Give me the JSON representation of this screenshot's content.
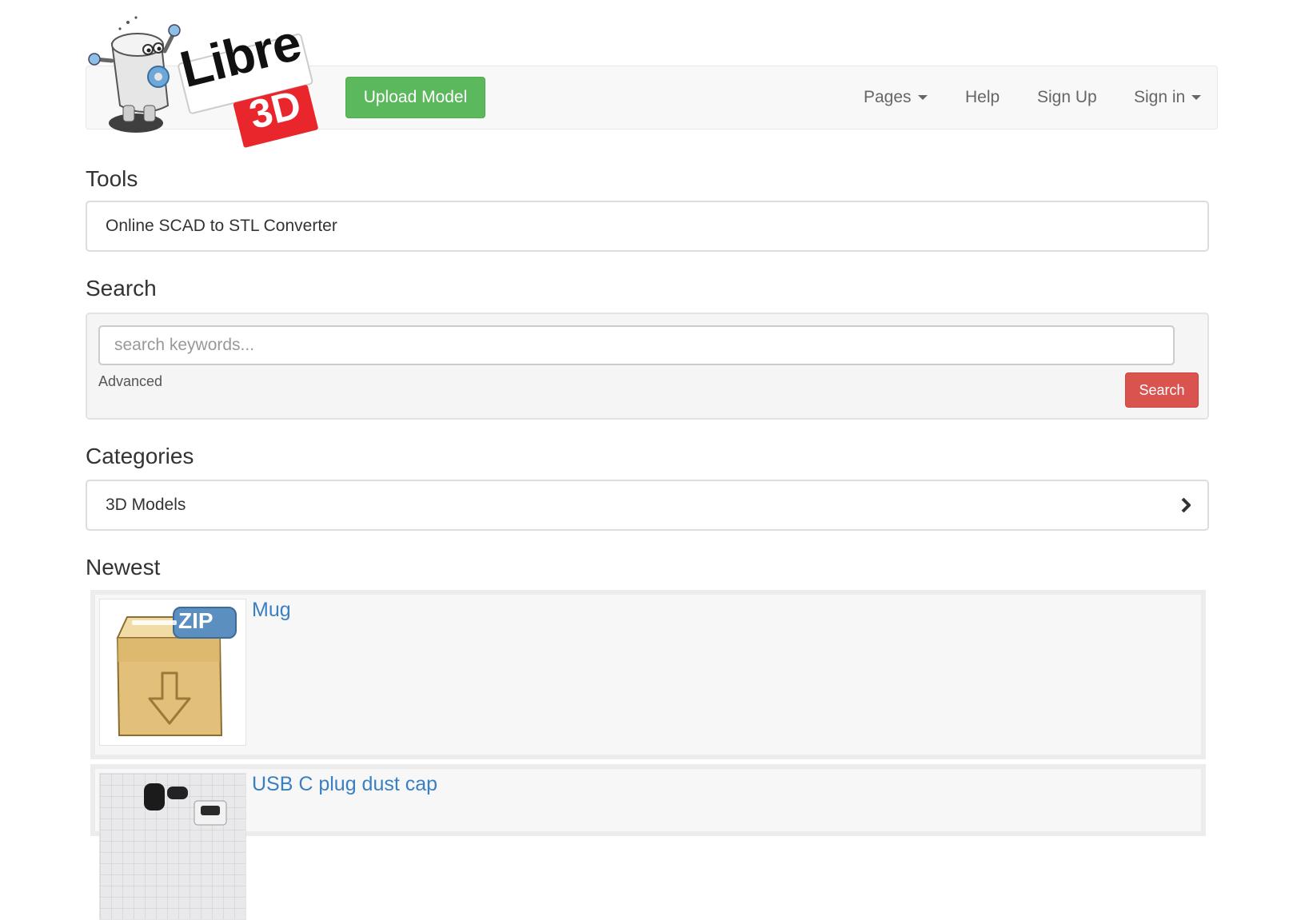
{
  "header": {
    "logo": {
      "word": "Libre",
      "badge": "3D",
      "icon": "robot-mascot-icon"
    },
    "upload_label": "Upload Model",
    "nav": {
      "pages_label": "Pages",
      "help_label": "Help",
      "signup_label": "Sign Up",
      "signin_label": "Sign in"
    }
  },
  "tools": {
    "heading": "Tools",
    "items": [
      "Online SCAD to STL Converter"
    ]
  },
  "search": {
    "heading": "Search",
    "placeholder": "search keywords...",
    "value": "",
    "advanced_label": "Advanced",
    "button_label": "Search"
  },
  "categories": {
    "heading": "Categories",
    "items": [
      {
        "label": "3D Models",
        "icon": "chevron-right-icon"
      }
    ]
  },
  "newest": {
    "heading": "Newest",
    "items": [
      {
        "title": "Mug",
        "thumbnail": "zip-archive-icon",
        "thumbnail_badge": "ZIP"
      },
      {
        "title": "USB C plug dust cap",
        "thumbnail": "photo-thumbnail"
      }
    ]
  },
  "colors": {
    "upload_button": "#5cb85c",
    "search_button": "#d9534f",
    "link": "#3a7fc1",
    "logo_red": "#e8262c",
    "navbar_bg": "#f8f8f8"
  }
}
